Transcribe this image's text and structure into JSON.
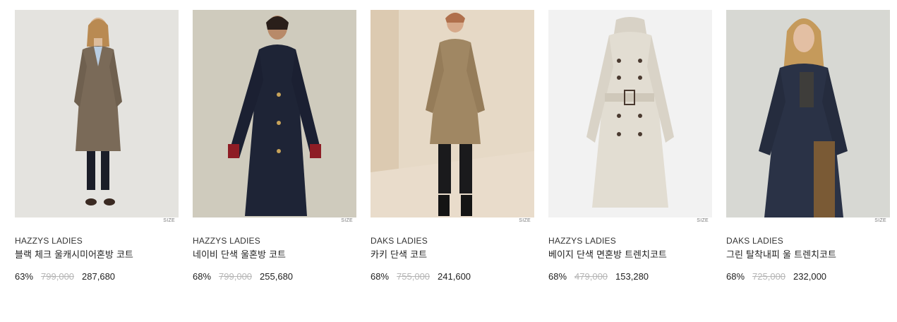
{
  "products": [
    {
      "brand": "HAZZYS LADIES",
      "name": "블랙 체크 울캐시미어혼방 코트",
      "size_label": "SIZE",
      "discount": "63%",
      "original_price": "799,000",
      "price": "287,680",
      "bg_color": "#e4e3df",
      "garment_color": "#7a6a58"
    },
    {
      "brand": "HAZZYS LADIES",
      "name": "네이비 단색 울혼방 코트",
      "size_label": "SIZE",
      "discount": "68%",
      "original_price": "799,000",
      "price": "255,680",
      "bg_color": "#cfcbbd",
      "garment_color": "#1e2436"
    },
    {
      "brand": "DAKS LADIES",
      "name": "카키 단색 코트",
      "size_label": "SIZE",
      "discount": "68%",
      "original_price": "755,000",
      "price": "241,600",
      "bg_color": "#e6d9c6",
      "garment_color": "#a08763"
    },
    {
      "brand": "HAZZYS LADIES",
      "name": "베이지 단색 면혼방 트렌치코트",
      "size_label": "SIZE",
      "discount": "68%",
      "original_price": "479,000",
      "price": "153,280",
      "bg_color": "#f2f2f2",
      "garment_color": "#e2ddd2"
    },
    {
      "brand": "DAKS LADIES",
      "name": "그린 탈착내피 울 트렌치코트",
      "size_label": "SIZE",
      "discount": "68%",
      "original_price": "725,000",
      "price": "232,000",
      "bg_color": "#d7d8d3",
      "garment_color": "#2a3246"
    }
  ]
}
